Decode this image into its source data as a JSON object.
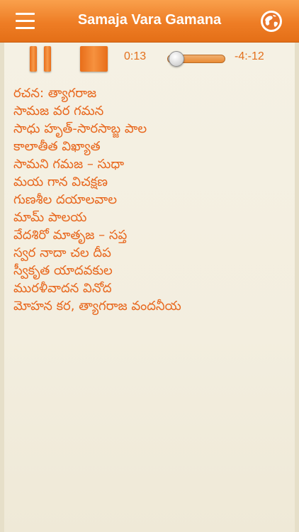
{
  "header": {
    "title": "Samaja Vara Gamana",
    "menu_icon": "hamburger-menu-icon",
    "globe_icon": "globe-icon"
  },
  "player": {
    "elapsed": "0:13",
    "remaining": "-4:-12",
    "progress": 0.15,
    "pause_icon": "pause-icon",
    "stop_icon": "stop-icon"
  },
  "lyrics": [
    "రచన: త్యాగరాజ",
    "సామజ వర గమన",
    "సాధు హృత్-సారసాబ్జ పాల",
    "కాలాతీత విఖ్యాత",
    "సామని గమజ – సుధా",
    "మయ గాన విచక్షణ",
    "గుణశీల దయాలవాల",
    "మామ్ పాలయ",
    "వేదశిరో మాతృజ – సప్త",
    "స్వర నాదా చల దీప",
    "స్వీకృత యాదవకుల",
    "మురళీవాదన వినోద",
    "మోహన కర, త్యాగరాజ వందనీయ"
  ],
  "colors": {
    "accent": "#ee7d25",
    "text": "#e8671d",
    "paper": "#f3eedf"
  }
}
